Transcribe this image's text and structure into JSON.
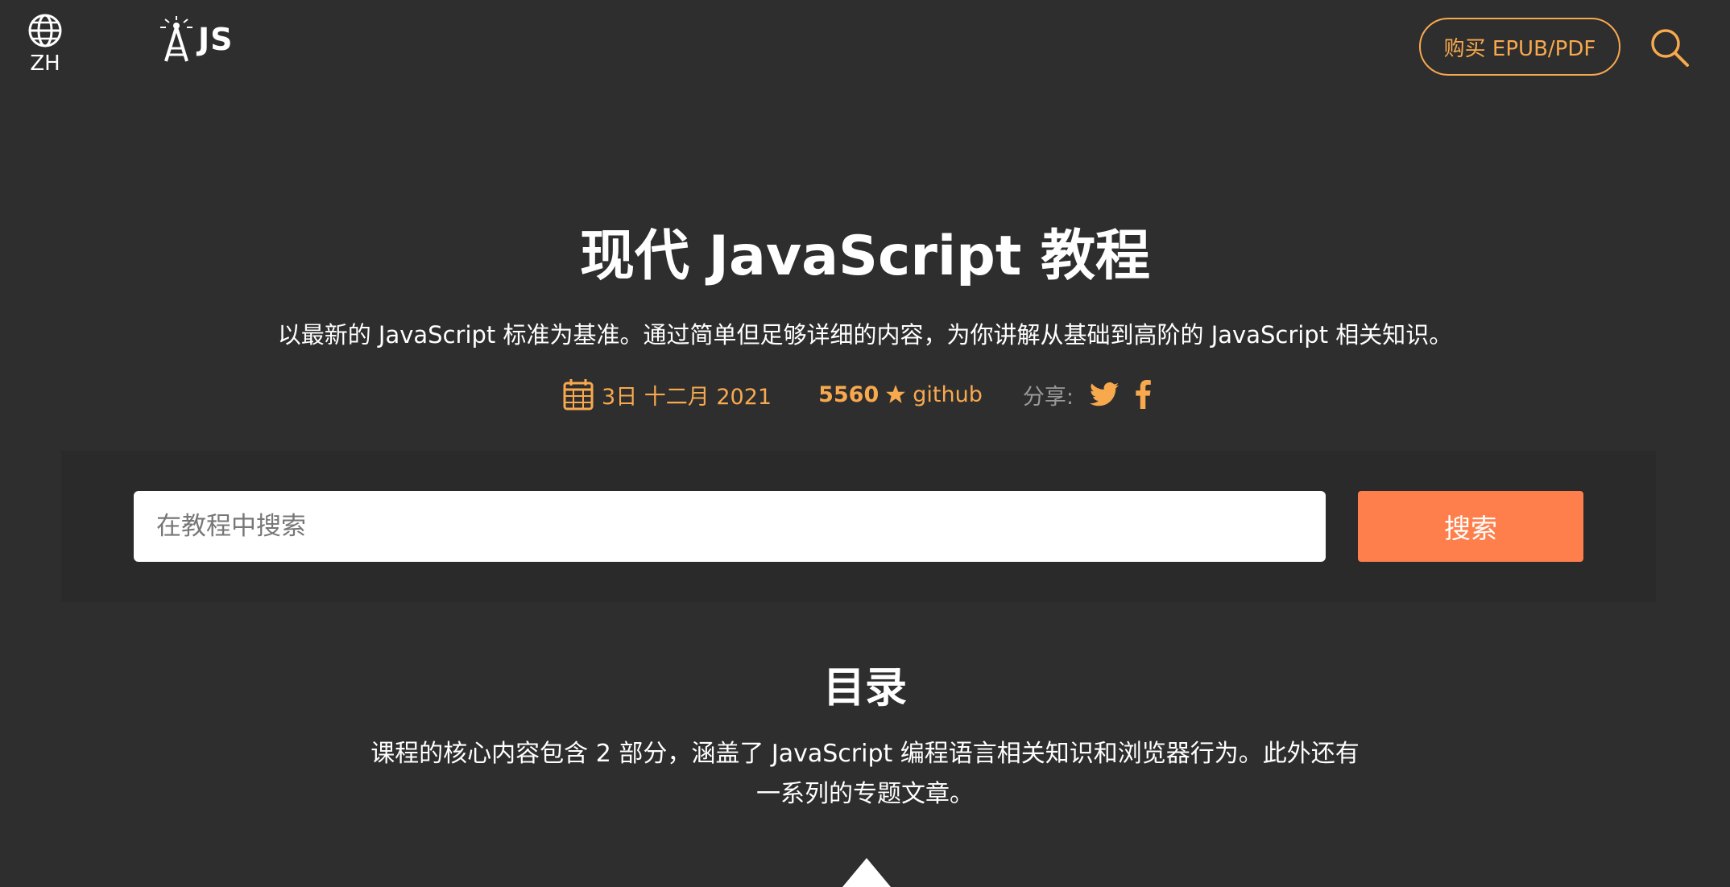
{
  "header": {
    "lang_label": "ZH",
    "logo_text": "JS",
    "buy_label": "购买 EPUB/PDF"
  },
  "hero": {
    "title": "现代 JavaScript 教程",
    "subtitle": "以最新的 JavaScript 标准为基准。通过简单但足够详细的内容，为你讲解从基础到高阶的 JavaScript 相关知识。"
  },
  "meta": {
    "date": "3日 十二月 2021",
    "stars": "5560",
    "github_label": "github",
    "share_label": "分享:"
  },
  "search": {
    "placeholder": "在教程中搜索",
    "button_label": "搜索"
  },
  "toc": {
    "title": "目录",
    "description_line1": "课程的核心内容包含 2 部分，涵盖了 JavaScript 编程语言相关知识和浏览器行为。此外还有",
    "description_line2": "一系列的专题文章。"
  },
  "colors": {
    "background": "#2e2e2e",
    "accent": "#f8a94e",
    "search_button": "#fe7f4b"
  }
}
